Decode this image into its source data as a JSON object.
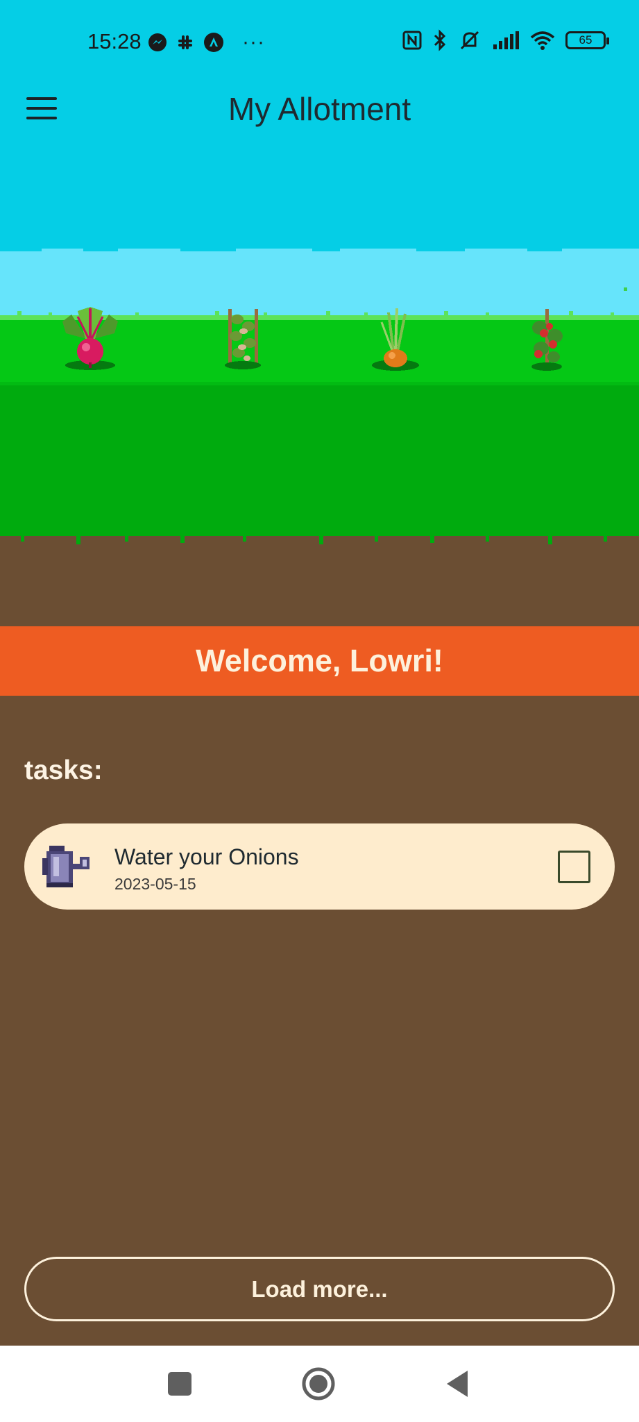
{
  "status_bar": {
    "time": "15:28",
    "more_indicator": "···",
    "battery_level": "65",
    "left_icons": [
      "messenger-icon",
      "slack-icon",
      "app-icon"
    ],
    "right_icons": [
      "nfc-icon",
      "bluetooth-icon",
      "mute-icon",
      "signal-icon",
      "wifi-icon",
      "battery-icon"
    ]
  },
  "app_bar": {
    "title": "My Allotment",
    "menu_icon": "hamburger-menu-icon"
  },
  "garden": {
    "plants": [
      "beetroot",
      "runner-beans",
      "onion",
      "tomato"
    ],
    "colors": {
      "sky": "#05cee6",
      "sky_light": "#66e4fb",
      "grass_light": "#05c815",
      "grass": "#00ab0e",
      "soil": "#6b4e33"
    }
  },
  "welcome": {
    "text": "Welcome, Lowri!"
  },
  "tasks": {
    "heading": "tasks:",
    "items": [
      {
        "title": "Water your Onions",
        "date": "2023-05-15",
        "icon": "watering-can-icon",
        "done": false
      }
    ]
  },
  "load_more": {
    "label": "Load more..."
  },
  "nav_bar": {
    "buttons": [
      "recents-button",
      "home-button",
      "back-button"
    ]
  },
  "colors": {
    "accent": "#ee5c22",
    "card": "#feeccd",
    "text_light": "#fdf1dc"
  }
}
